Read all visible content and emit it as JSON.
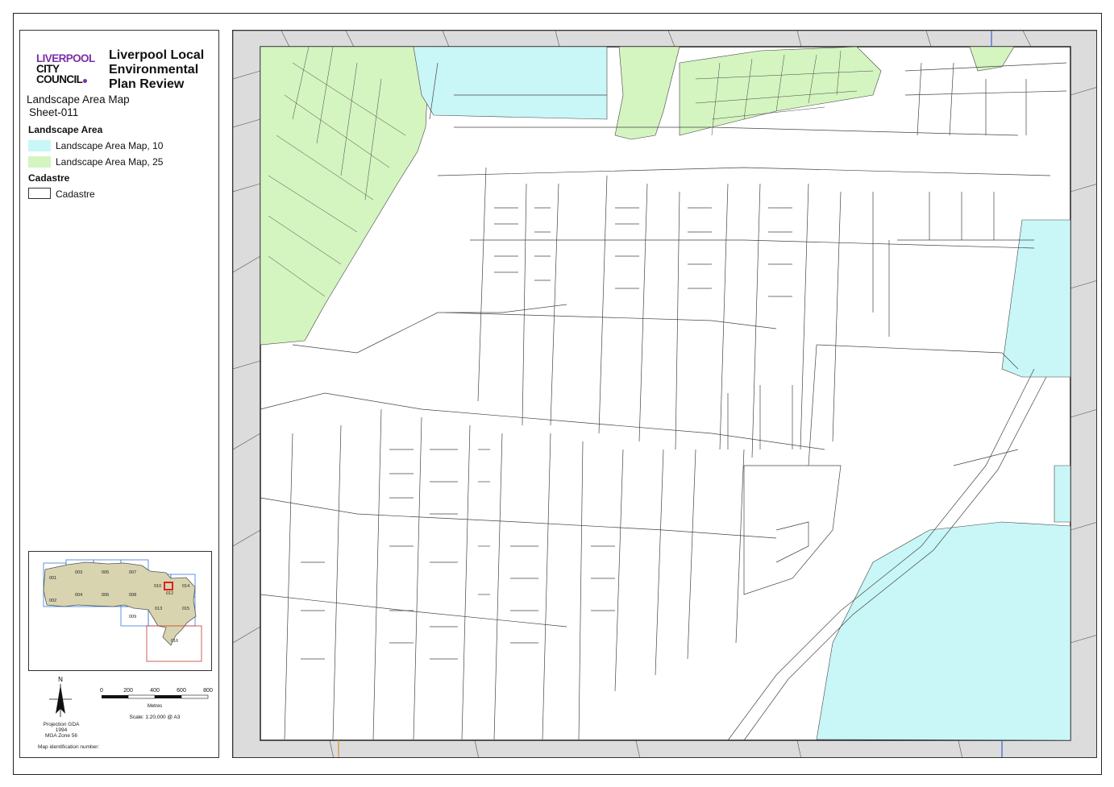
{
  "header": {
    "logo_line1": "LIVERPOOL",
    "logo_line2": "CITY",
    "logo_line3": "COUNCIL",
    "title": "Liverpool Local Environmental Plan Review",
    "map_name": "Landscape Area Map",
    "sheet": "Sheet-011"
  },
  "legend": {
    "section1": "Landscape Area",
    "items": [
      {
        "label": "Landscape Area Map, 10",
        "color": "#c9f6f6"
      },
      {
        "label": "Landscape Area Map, 25",
        "color": "#d4f4c0"
      }
    ],
    "section2": "Cadastre",
    "cadastre_label": "Cadastre"
  },
  "overview": {
    "tiles": [
      "001",
      "002",
      "003",
      "004",
      "005",
      "006",
      "007",
      "008",
      "009",
      "010",
      "013",
      "014",
      "015",
      "016",
      "012"
    ]
  },
  "scale": {
    "ticks": [
      "0",
      "200",
      "400",
      "600",
      "800"
    ],
    "unit": "Metres",
    "scale_text": "Scale: 1:20,000 @ A3",
    "north": "N",
    "projection_line1": "Projection GDA 1994",
    "projection_line2": "MGA Zone 56",
    "map_id": "Map identification number:"
  },
  "colors": {
    "landscape_10": "#c9f6f6",
    "landscape_25": "#d4f4c0",
    "outside": "#dcdcdc",
    "cadastre_line": "#444444"
  }
}
